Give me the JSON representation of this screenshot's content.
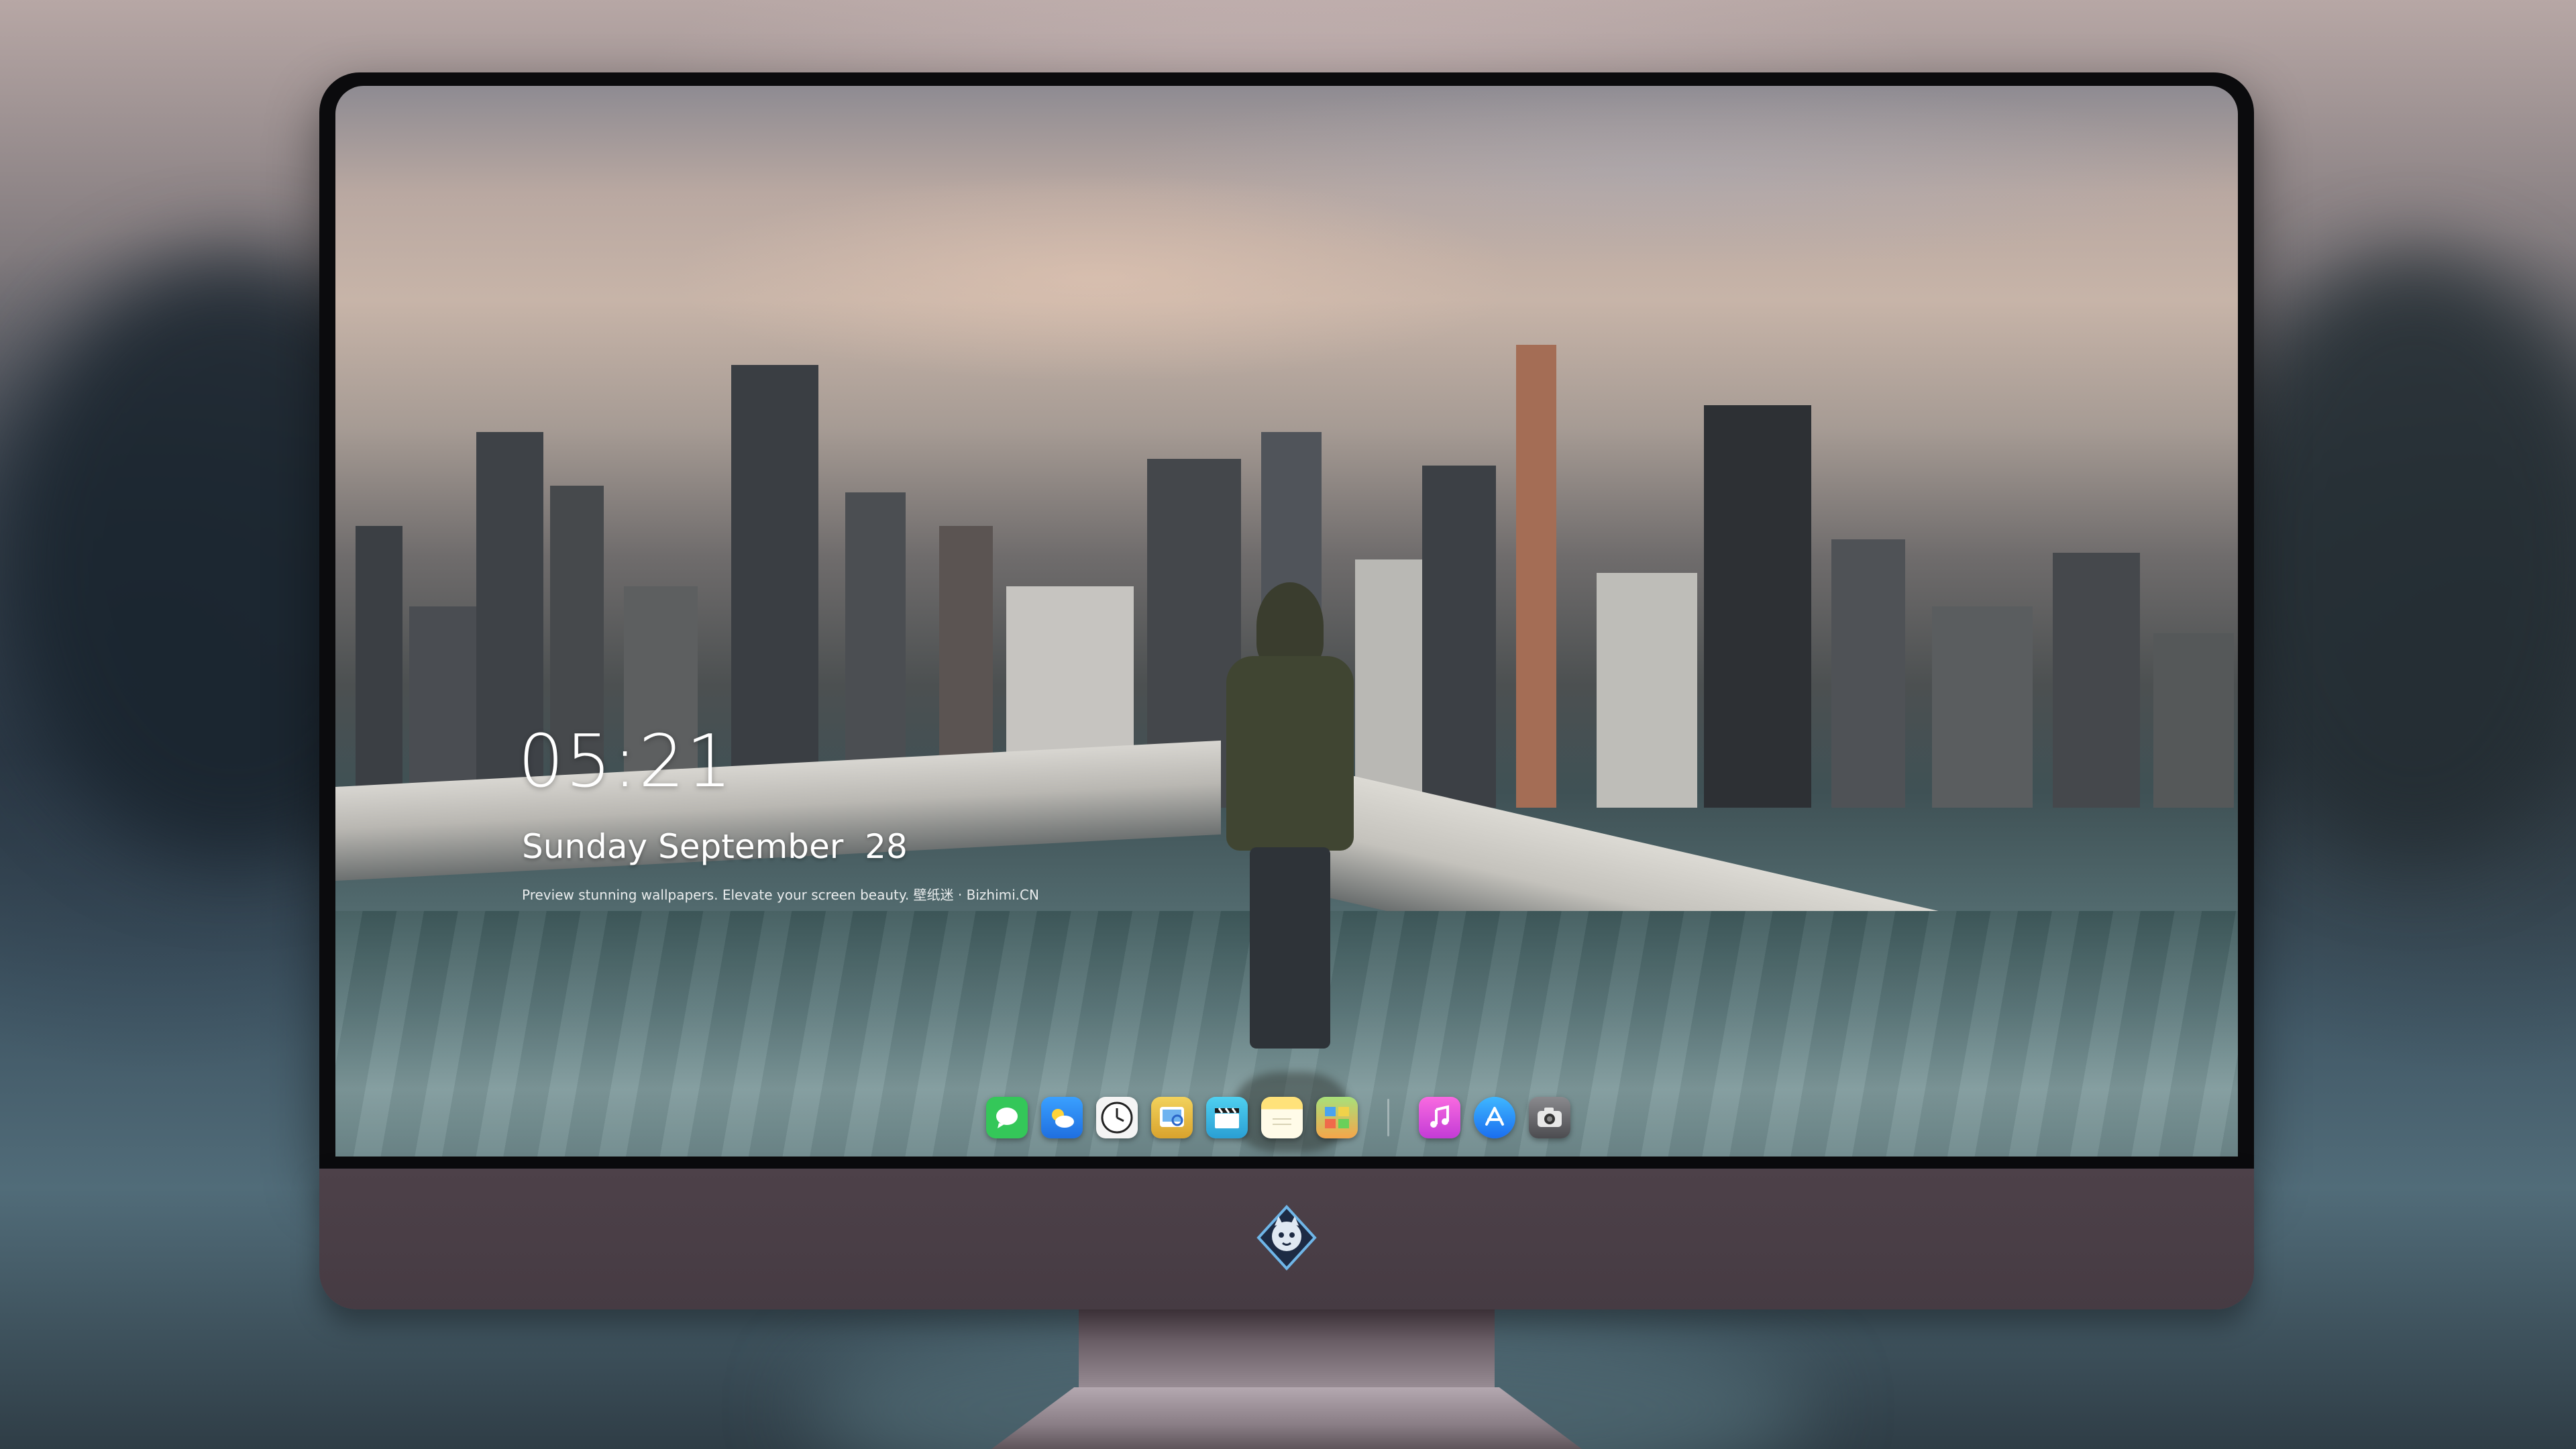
{
  "lock_screen": {
    "time": "05:21",
    "date": "Sunday September  28",
    "caption": "Preview stunning wallpapers. Elevate your screen beauty. 壁纸迷 · Bizhimi.CN"
  },
  "dock": {
    "apps": [
      {
        "name": "messages-icon",
        "glyph": "💬",
        "color": "#34c759"
      },
      {
        "name": "weather-icon",
        "glyph": "⛅",
        "color": "#2f8cf5"
      },
      {
        "name": "clock-icon",
        "glyph": "🕐",
        "color": "#f5f5f5"
      },
      {
        "name": "preview-icon",
        "glyph": "🖼",
        "color": "#e8c54a"
      },
      {
        "name": "final-cut-icon",
        "glyph": "🎬",
        "color": "#3dc0e6"
      },
      {
        "name": "notes-icon",
        "glyph": "📝",
        "color": "#ffd84a"
      },
      {
        "name": "photo-gallery-icon",
        "glyph": "🗺",
        "color": "#f0a23c"
      }
    ],
    "pinned": [
      {
        "name": "music-icon",
        "glyph": "♫",
        "color": "#e84fd3"
      },
      {
        "name": "app-store-icon",
        "glyph": "A",
        "color": "#1a8cf5"
      },
      {
        "name": "camera-icon",
        "glyph": "📷",
        "color": "#5a5a5e"
      }
    ]
  },
  "colors": {
    "bezel": "#0b0b0d",
    "chin": "#4d4149",
    "accent_white": "#ffffff"
  }
}
